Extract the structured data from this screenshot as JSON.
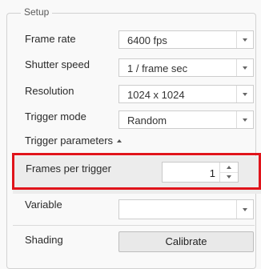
{
  "group_title": "Setup",
  "fields": {
    "frame_rate": {
      "label": "Frame rate",
      "value": "6400 fps"
    },
    "shutter_speed": {
      "label": "Shutter speed",
      "value": "1 / frame sec"
    },
    "resolution": {
      "label": "Resolution",
      "value": "1024 x 1024"
    },
    "trigger_mode": {
      "label": "Trigger mode",
      "value": "Random"
    }
  },
  "trigger_parameters": {
    "label": "Trigger parameters",
    "frames_per_trigger": {
      "label": "Frames per trigger",
      "value": "1"
    }
  },
  "variable": {
    "label": "Variable",
    "value": ""
  },
  "shading": {
    "label": "Shading",
    "button_label": "Calibrate"
  },
  "highlight_color": "#e0141b"
}
